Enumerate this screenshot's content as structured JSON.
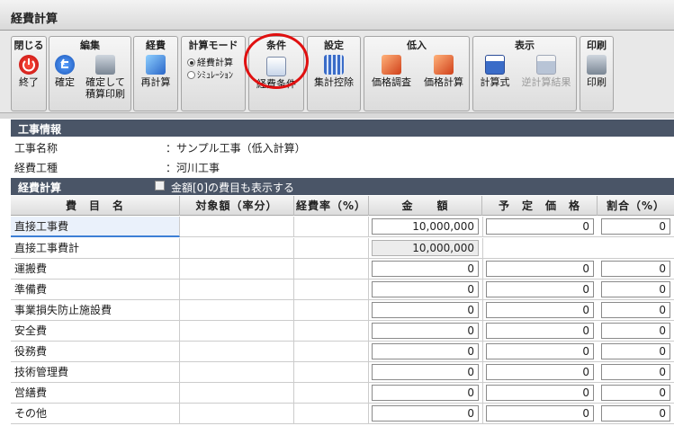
{
  "window": {
    "title": "経費計算"
  },
  "ribbon": {
    "close": {
      "title": "閉じる",
      "exit_label": "終了"
    },
    "edit": {
      "title": "編集",
      "confirm_label": "確定",
      "confirm_print_label_1": "確定して",
      "confirm_print_label_2": "積算印刷"
    },
    "expense": {
      "title": "経費",
      "recalc_label": "再計算"
    },
    "calc_mode": {
      "title": "計算モード",
      "options": [
        "経費計算",
        "ｼﾐｭﾚｰｼｮﾝ"
      ],
      "selected": "経費計算"
    },
    "condition": {
      "title": "条件",
      "expense_condition_label": "経費条件"
    },
    "settings": {
      "title": "設定",
      "total_deduction_label": "集計控除"
    },
    "bid": {
      "title": "低入",
      "price_survey_label": "価格調査",
      "price_calc_label": "価格計算"
    },
    "display": {
      "title": "表示",
      "formula_label": "計算式",
      "reverse_calc_label": "逆計算結果"
    },
    "print": {
      "title": "印刷",
      "print_label": "印刷"
    }
  },
  "project_info": {
    "header": "工事情報",
    "name_label": "工事名称",
    "name_value": "：サンプル工事（低入計算）",
    "type_label": "経費工種",
    "type_value": "：河川工事"
  },
  "expense_calc": {
    "header": "経費計算",
    "show_zero_label": "金額[0]の費目も表示する",
    "show_zero_checked": false
  },
  "table": {
    "columns": [
      "費　目　名",
      "対象額（率分）",
      "経費率（%）",
      "金　　額",
      "予　定　価　格",
      "割合（%）"
    ],
    "rows": [
      {
        "name": "直接工事費",
        "amount": "10,000,000",
        "planned": "0",
        "ratio": "0",
        "selected": true
      },
      {
        "name": "直接工事費計",
        "amount": "10,000,000",
        "planned": "",
        "ratio": "",
        "readonly": true
      },
      {
        "name": "運搬費",
        "amount": "0",
        "planned": "0",
        "ratio": "0"
      },
      {
        "name": "準備費",
        "amount": "0",
        "planned": "0",
        "ratio": "0"
      },
      {
        "name": "事業損失防止施設費",
        "amount": "0",
        "planned": "0",
        "ratio": "0"
      },
      {
        "name": "安全費",
        "amount": "0",
        "planned": "0",
        "ratio": "0"
      },
      {
        "name": "役務費",
        "amount": "0",
        "planned": "0",
        "ratio": "0"
      },
      {
        "name": "技術管理費",
        "amount": "0",
        "planned": "0",
        "ratio": "0"
      },
      {
        "name": "営繕費",
        "amount": "0",
        "planned": "0",
        "ratio": "0"
      },
      {
        "name": "その他",
        "amount": "0",
        "planned": "0",
        "ratio": "0"
      }
    ]
  },
  "colors": {
    "section_header": "#4a5567",
    "highlight": "#e01010",
    "selection": "#3d7fd6"
  }
}
